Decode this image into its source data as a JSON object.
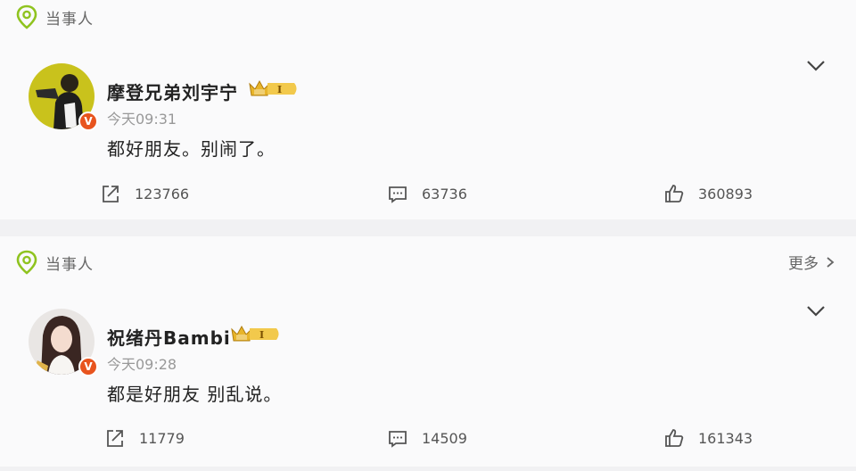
{
  "posts": [
    {
      "tag_label": "当事人",
      "user": {
        "name": "摩登兄弟刘宇宁",
        "level": "I",
        "verified_mark": "V"
      },
      "time": "今天09:31",
      "text": "都好朋友。别闹了。",
      "stats": {
        "reposts": "123766",
        "comments": "63736",
        "likes": "360893"
      },
      "more_label": ""
    },
    {
      "tag_label": "当事人",
      "user": {
        "name": "祝绪丹Bambi",
        "level": "I",
        "verified_mark": "V"
      },
      "time": "今天09:28",
      "text": "都是好朋友 别乱说。",
      "stats": {
        "reposts": "11779",
        "comments": "14509",
        "likes": "161343"
      },
      "more_label": "更多"
    }
  ],
  "colors": {
    "tag_icon": "#8fc31f",
    "verified_badge": "#e8541e",
    "crown_gold": "#e8b52a",
    "background": "#f1f1f3"
  },
  "icons": [
    "location-tag-icon",
    "chevron-down-icon",
    "repost-icon",
    "comment-icon",
    "like-icon",
    "chevron-right-icon"
  ]
}
